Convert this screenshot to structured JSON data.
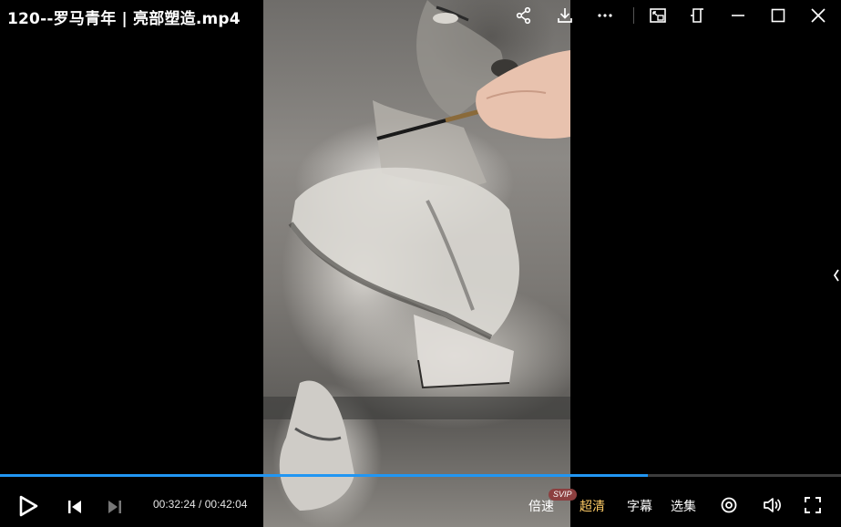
{
  "window": {
    "title": "120--罗马青年 | 亮部塑造.mp4"
  },
  "titlebar_icons": [
    "share-icon",
    "download-icon",
    "more-icon",
    "picture-in-picture-icon",
    "pin-icon",
    "minimize-icon",
    "maximize-icon",
    "close-icon"
  ],
  "player": {
    "current_time": "00:32:24",
    "total_time": "00:42:04",
    "time_separator": " / ",
    "progress_fraction": 0.77,
    "accent_color": "#2196f3"
  },
  "controls": {
    "speed_label": "倍速",
    "speed_badge": "SVIP",
    "quality_label": "超清",
    "subtitle_label": "字幕",
    "episode_label": "选集"
  }
}
